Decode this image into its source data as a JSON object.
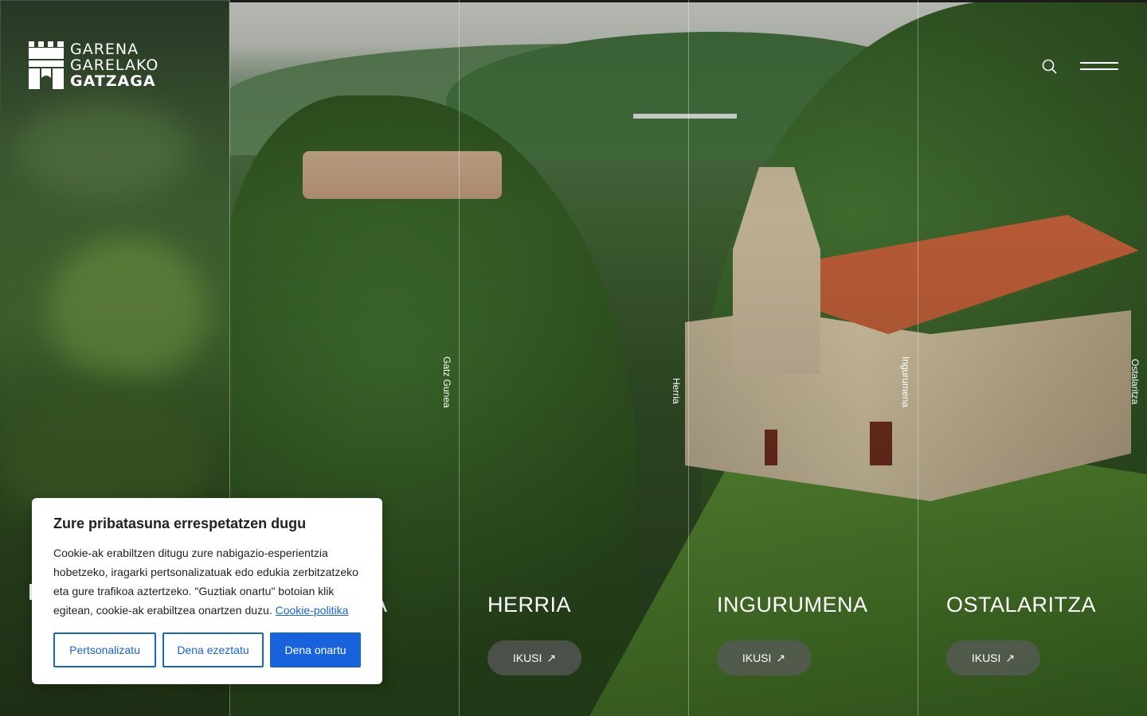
{
  "brand": {
    "line1": "GARENA",
    "line2": "GARELAKO",
    "line3": "GATZAGA"
  },
  "header": {
    "search_icon": "search-icon",
    "menu_icon": "hamburger-menu-icon"
  },
  "sections": [
    {
      "title": "HERRIA",
      "button": "IKUSI"
    },
    {
      "title": "INGURUMENA",
      "button": "IKUSI"
    },
    {
      "title": "OSTALARITZA",
      "button": "IKUSI"
    }
  ],
  "partial_section_title": "A",
  "vertical_tabs": [
    {
      "label": "Gatz Gunea"
    },
    {
      "label": "Herria"
    },
    {
      "label": "Ingurumena"
    },
    {
      "label": "Ostalaritza"
    }
  ],
  "cookie": {
    "title": "Zure pribatasuna errespetatzen dugu",
    "body": "Cookie-ak erabiltzen ditugu zure nabigazio-esperientzia hobetzeko, iragarki pertsonalizatuak edo edukia zerbitzatzeko eta gure trafikoa aztertzeko. \"Guztiak onartu\" botoian klik egitean, cookie-ak erabiltzea onartzen duzu.",
    "link": "Cookie-politika",
    "customize": "Pertsonalizatu",
    "reject": "Dena ezeztatu",
    "accept": "Dena onartu"
  },
  "colors": {
    "accent": "#1863dc"
  }
}
